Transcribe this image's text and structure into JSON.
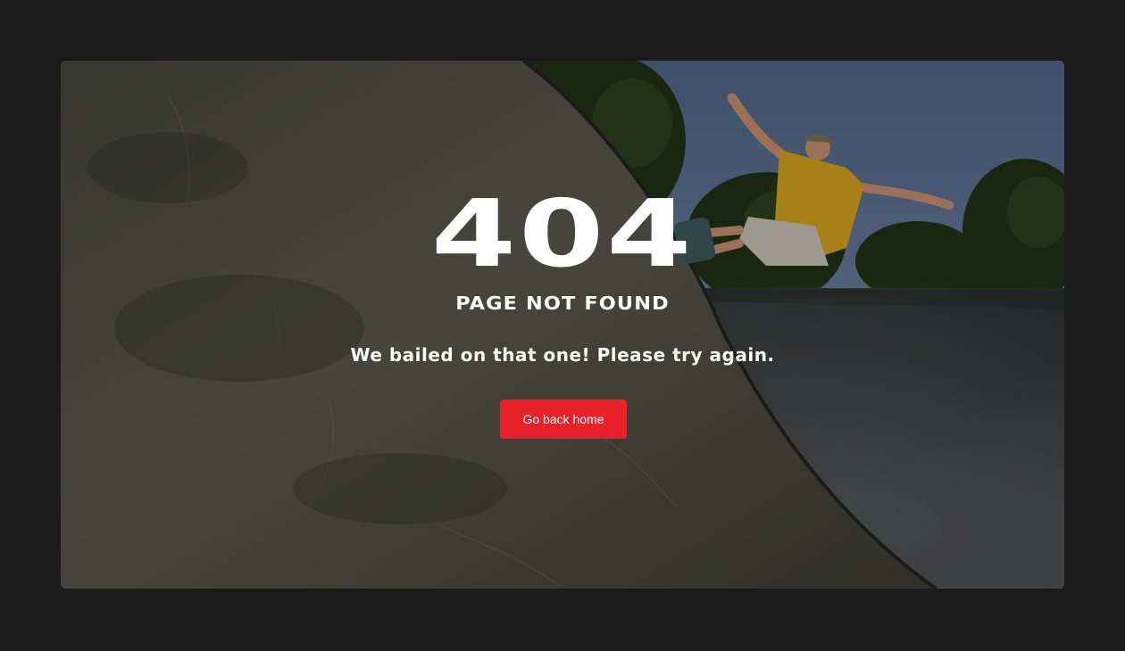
{
  "error": {
    "code": "404",
    "title": "PAGE NOT FOUND",
    "message": "We bailed on that one! Please try again."
  },
  "actions": {
    "home_button_label": "Go back home"
  },
  "hero_image": {
    "description_icon": "skateboarder-photo"
  },
  "colors": {
    "page_background": "#1b1b1b",
    "button_background": "#e8202a",
    "text": "#ffffff"
  }
}
